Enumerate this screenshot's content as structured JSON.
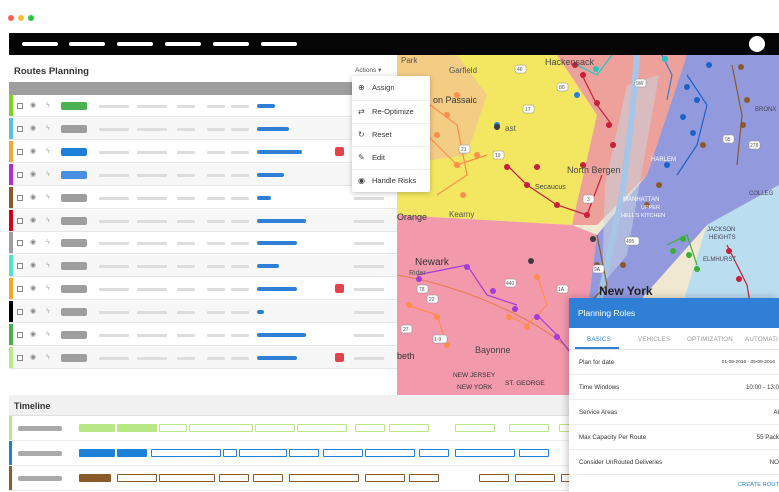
{
  "window": {
    "controls": [
      {
        "name": "close-dot",
        "color": "#ff5f57"
      },
      {
        "name": "minimize-dot",
        "color": "#ffbd2e"
      },
      {
        "name": "maximize-dot",
        "color": "#28c940"
      }
    ]
  },
  "panel": {
    "title": "Routes Planning",
    "actions_label": "Actions ▾"
  },
  "actions_menu": {
    "items": [
      {
        "label": "Assign",
        "icon": "plus-circle-icon"
      },
      {
        "label": "Re-Optimize",
        "icon": "swap-icon"
      },
      {
        "label": "Reset",
        "icon": "reset-icon"
      },
      {
        "label": "Edit",
        "icon": "pencil-icon"
      },
      {
        "label": "Handle Risks",
        "icon": "target-icon"
      }
    ]
  },
  "routes": [
    {
      "color": "#4caf50",
      "stripe": "#7ed321",
      "progress": 0.25,
      "flag": false
    },
    {
      "color": "#9e9e9e",
      "stripe": "#5bc0de",
      "progress": 0.45,
      "flag": false
    },
    {
      "color": "#1e7fd8",
      "stripe": "#f2a53b",
      "progress": 0.63,
      "flag": true
    },
    {
      "color": "#4a90e2",
      "stripe": "#b12cd1",
      "progress": 0.38,
      "flag": false
    },
    {
      "color": "#9e9e9e",
      "stripe": "#8b5a2b",
      "progress": 0.2,
      "flag": false
    },
    {
      "color": "#9e9e9e",
      "stripe": "#d0021b",
      "progress": 0.68,
      "flag": false
    },
    {
      "color": "#9e9e9e",
      "stripe": "#9e9e9e",
      "progress": 0.55,
      "flag": false
    },
    {
      "color": "#9e9e9e",
      "stripe": "#50e3c2",
      "progress": 0.3,
      "flag": false
    },
    {
      "color": "#9e9e9e",
      "stripe": "#f5a623",
      "progress": 0.55,
      "flag": true
    },
    {
      "color": "#9e9e9e",
      "stripe": "#000000",
      "progress": 0.1,
      "flag": false
    },
    {
      "color": "#9e9e9e",
      "stripe": "#4caf50",
      "progress": 0.68,
      "flag": false
    },
    {
      "color": "#9e9e9e",
      "stripe": "#b8e986",
      "progress": 0.55,
      "flag": true
    }
  ],
  "map": {
    "labels": [
      "Park",
      "Garfield",
      "Hackensack",
      "Passaic",
      "ast",
      "North Bergen",
      "Secaucus",
      "Kearny",
      "Orange",
      "Newark",
      "Bayonne",
      "New York",
      "HARLEM",
      "MANHATTAN",
      "HELL'S KITCHEN",
      "UPPER",
      "JACKSON HEIGHTS",
      "ELMHURST",
      "COLLEG",
      "BRONX",
      "NEW JERSEY",
      "ST. GEORGE",
      "beth",
      "NEW YORK",
      "Rider"
    ],
    "road_numbers": [
      "46",
      "19",
      "21",
      "17",
      "3",
      "9W",
      "95",
      "278",
      "9A",
      "1A",
      "495",
      "440",
      "78",
      "22",
      "1-9",
      "27",
      "80"
    ]
  },
  "timeline": {
    "title": "Timeline",
    "rows": [
      {
        "color": "#b8e986",
        "stripe": "#b8e986"
      },
      {
        "color": "#1e7fd8",
        "stripe": "#1e7fd8"
      },
      {
        "color": "#8b5a2b",
        "stripe": "#8b5a2b"
      }
    ]
  },
  "planning_roles": {
    "title": "Planning Roles",
    "tabs": [
      "BASICS",
      "VEHICLES",
      "OPTIMIZATION",
      "AUTOMATI"
    ],
    "active_tab": "BASICS",
    "rows": [
      {
        "label": "Plan for date",
        "value": "01-08-2016 - 05-09-2016"
      },
      {
        "label": "Time Windows",
        "value": "10:00 - 13:0"
      },
      {
        "label": "Service Areas",
        "value": "Al"
      },
      {
        "label": "Max Capacity Per Route",
        "value": "55 Pack"
      },
      {
        "label": "Consider UnRouted Deliveries",
        "value": "NO"
      }
    ],
    "create_label": "CREATE ROUT"
  }
}
